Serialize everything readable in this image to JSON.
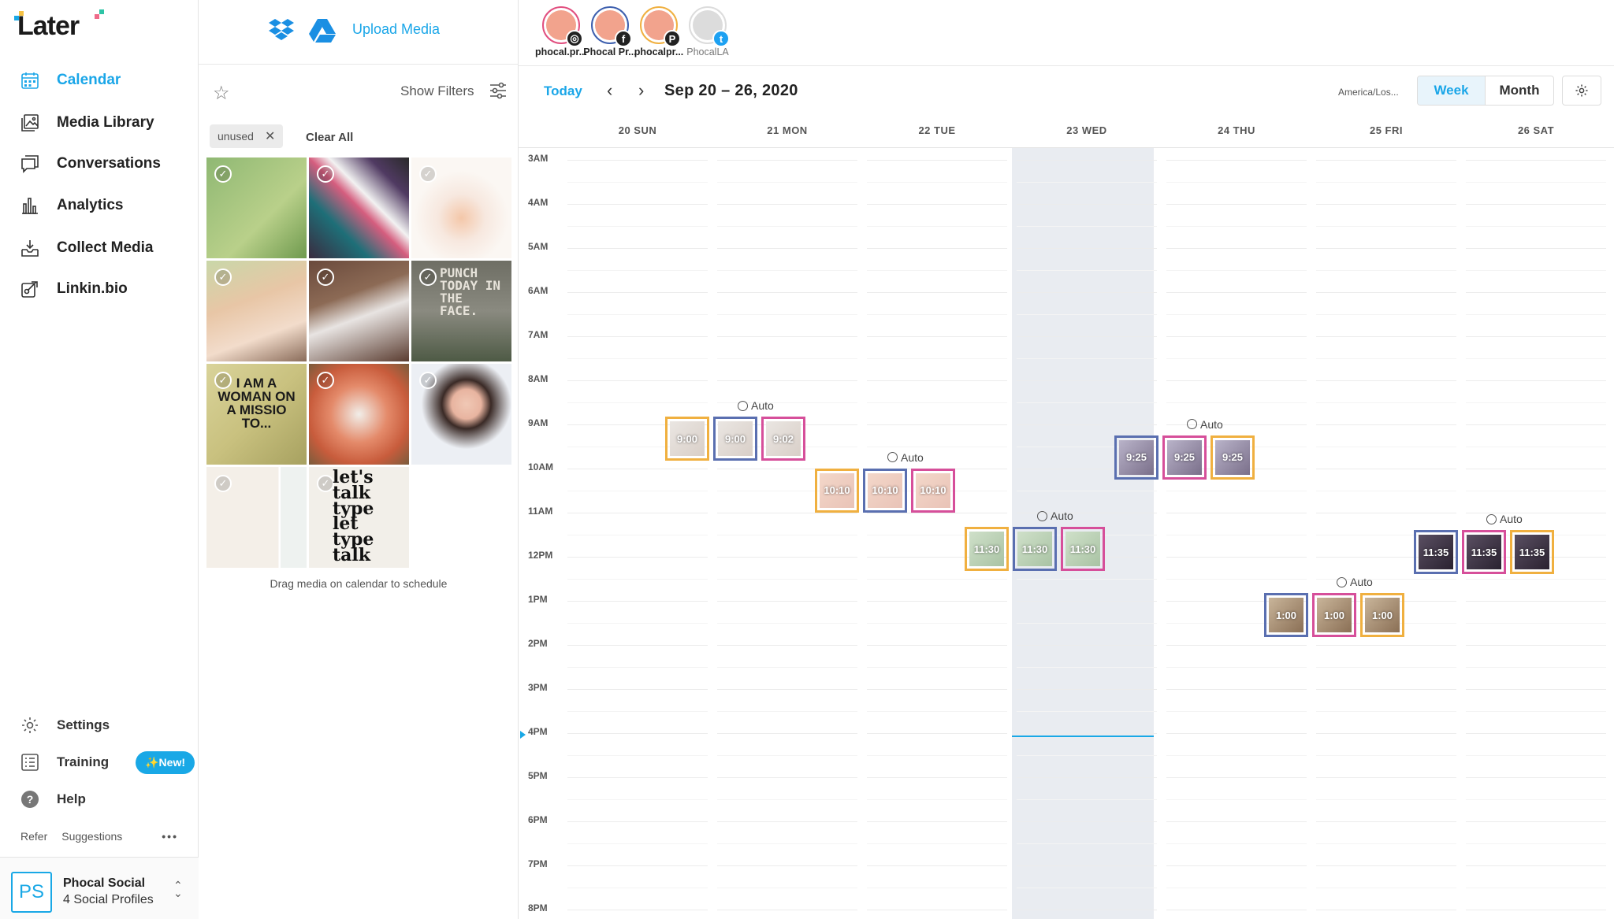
{
  "nav": {
    "logo": "Later",
    "items": [
      {
        "label": "Calendar",
        "icon": "calendar-icon",
        "active": true
      },
      {
        "label": "Media Library",
        "icon": "media-library-icon"
      },
      {
        "label": "Conversations",
        "icon": "conversations-icon"
      },
      {
        "label": "Analytics",
        "icon": "analytics-icon"
      },
      {
        "label": "Collect Media",
        "icon": "collect-media-icon"
      },
      {
        "label": "Linkin.bio",
        "icon": "linkinbio-icon"
      }
    ],
    "settings": "Settings",
    "training": "Training",
    "new_badge": "✨New!",
    "help": "Help",
    "refer": "Refer",
    "suggestions": "Suggestions",
    "more": "•••",
    "profile": {
      "initials": "PS",
      "name": "Phocal Social",
      "sub": "4 Social Profiles"
    }
  },
  "media": {
    "upload_label": "Upload Media",
    "show_filters": "Show Filters",
    "tag": "unused",
    "clear_all": "Clear All",
    "thumb_texts": [
      "",
      "",
      "",
      "",
      "",
      "PUNCH TODAY IN THE FACE.",
      "I AM A WOMAN ON A MISSIO TO...",
      "",
      "",
      "",
      "let's talk type let type talk"
    ],
    "drag_hint": "Drag media on calendar to schedule"
  },
  "calendar": {
    "profiles": [
      {
        "name": "phocal.pr...",
        "network": "instagram-icon",
        "glyph": "◎"
      },
      {
        "name": "Phocal Pr...",
        "network": "facebook-icon",
        "glyph": "f"
      },
      {
        "name": "phocalpr...",
        "network": "pinterest-icon",
        "glyph": "P"
      },
      {
        "name": "PhocalLA",
        "network": "twitter-icon",
        "glyph": "t"
      }
    ],
    "today_btn": "Today",
    "prev": "‹",
    "next": "›",
    "range": "Sep 20 – 26, 2020",
    "timezone": "America/Los...",
    "view_week": "Week",
    "view_month": "Month",
    "days": [
      "20 SUN",
      "21 MON",
      "22 TUE",
      "23 WED",
      "24 THU",
      "25 FRI",
      "26 SAT"
    ],
    "hours": [
      "3AM",
      "4AM",
      "5AM",
      "6AM",
      "7AM",
      "8AM",
      "9AM",
      "10AM",
      "11AM",
      "12PM",
      "1PM",
      "2PM",
      "3PM",
      "4PM",
      "5PM",
      "6PM",
      "7PM",
      "8PM"
    ],
    "auto_label": "Auto",
    "posts": [
      {
        "day": 1,
        "time_label": [
          "9:00",
          "9:00",
          "9:02"
        ],
        "auto": true
      },
      {
        "day": 2,
        "time_label": [
          "10:10",
          "10:10",
          "10:10"
        ],
        "auto": true
      },
      {
        "day": 3,
        "time_label": [
          "11:30",
          "11:30",
          "11:30"
        ],
        "auto": true
      },
      {
        "day": 4,
        "time_label": [
          "9:25",
          "9:25",
          "9:25"
        ],
        "auto": true
      },
      {
        "day": 5,
        "time_label": [
          "1:00",
          "1:00",
          "1:00"
        ],
        "auto": true
      },
      {
        "day": 6,
        "time_label": [
          "11:35",
          "11:35",
          "11:35"
        ],
        "auto": true
      }
    ]
  }
}
